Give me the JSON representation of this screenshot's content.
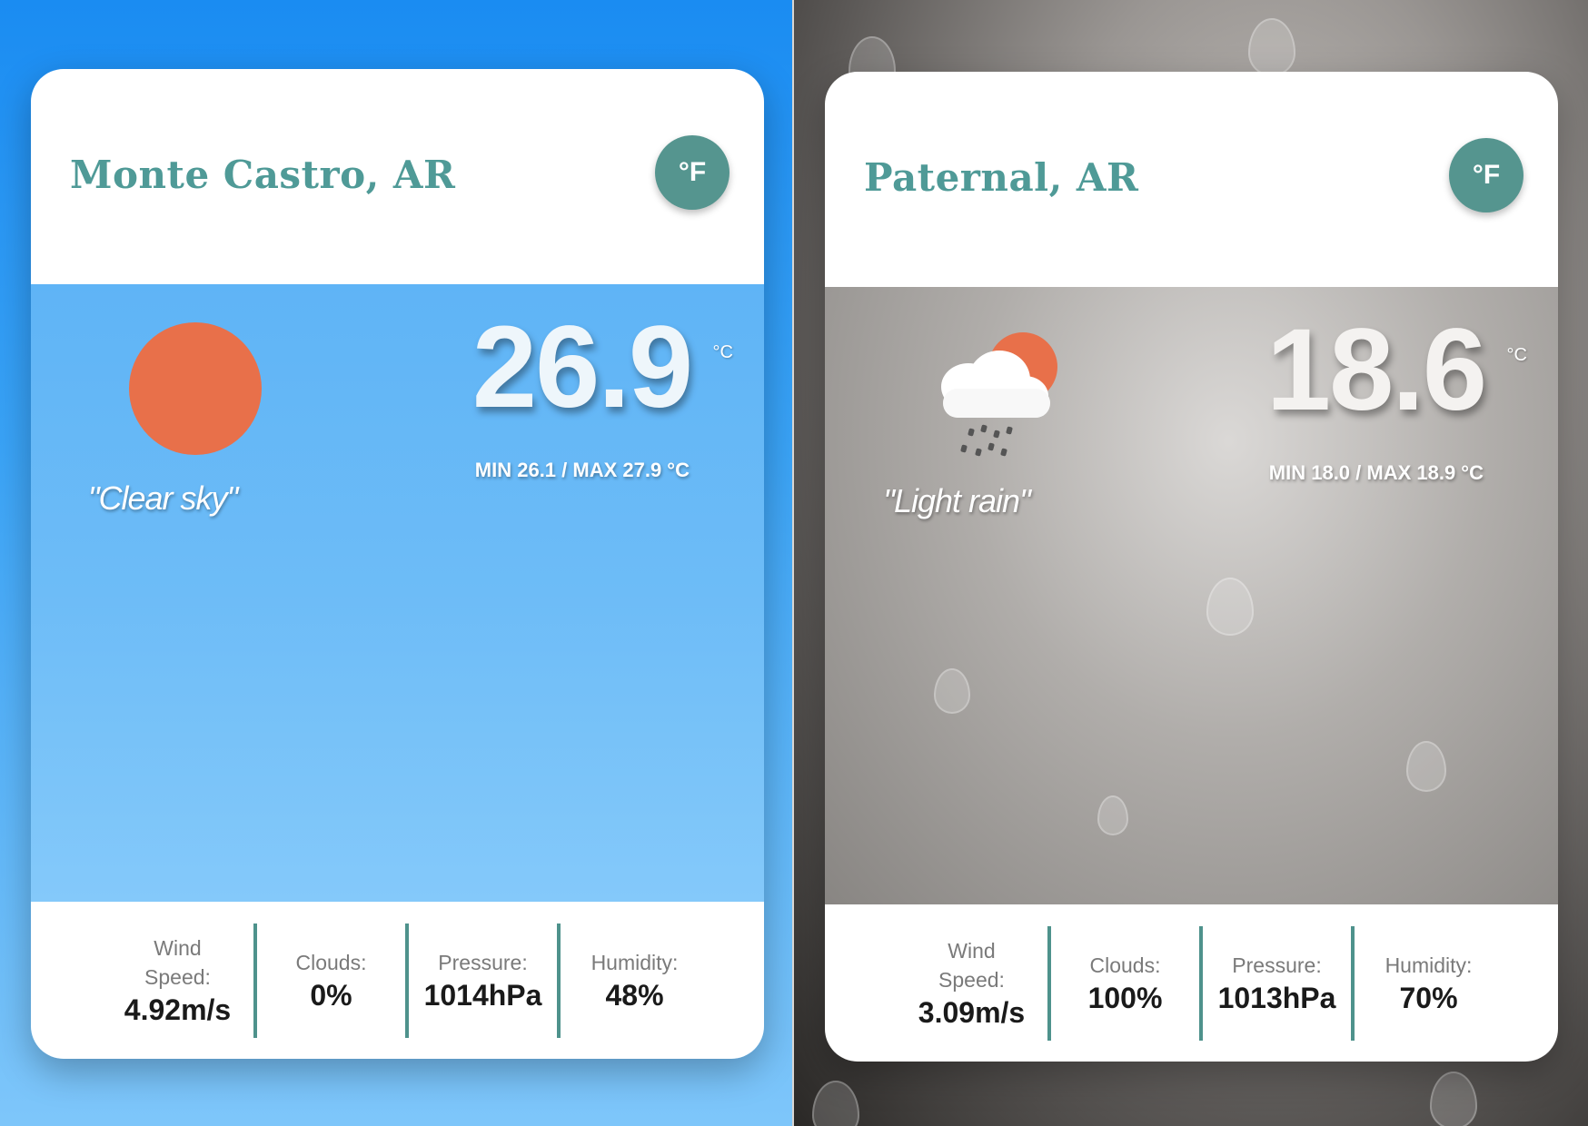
{
  "cards": [
    {
      "city": "Monte Castro, AR",
      "unit_toggle": "°F",
      "description": "\"Clear sky\"",
      "icon": "sun-icon",
      "temperature": "26.9",
      "temp_unit": "°C",
      "minmax": "MIN 26.1 / MAX 27.9 °C",
      "stats": [
        {
          "label": "Wind Speed:",
          "value": "4.92m/s"
        },
        {
          "label": "Clouds:",
          "value": "0%"
        },
        {
          "label": "Pressure:",
          "value": "1014hPa"
        },
        {
          "label": "Humidity:",
          "value": "48%"
        }
      ]
    },
    {
      "city": "Paternal, AR",
      "unit_toggle": "°F",
      "description": "\"Light rain\"",
      "icon": "rain-cloud-sun-icon",
      "temperature": "18.6",
      "temp_unit": "°C",
      "minmax": "MIN 18.0 / MAX 18.9 °C",
      "stats": [
        {
          "label": "Wind Speed:",
          "value": "3.09m/s"
        },
        {
          "label": "Clouds:",
          "value": "100%"
        },
        {
          "label": "Pressure:",
          "value": "1013hPa"
        },
        {
          "label": "Humidity:",
          "value": "70%"
        }
      ]
    }
  ],
  "colors": {
    "accent": "#55958f",
    "sun": "#e8704a",
    "sky_top": "#1a8cf2",
    "sky_bottom": "#7ec6fa"
  }
}
